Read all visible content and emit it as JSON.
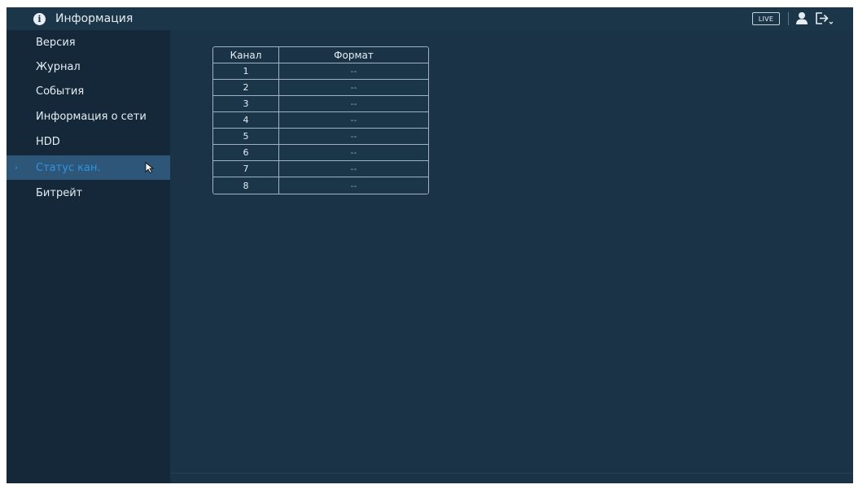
{
  "header": {
    "title": "Информация",
    "live_label": "LIVE"
  },
  "sidebar": {
    "items": [
      {
        "label": "Версия"
      },
      {
        "label": "Журнал"
      },
      {
        "label": "События"
      },
      {
        "label": "Информация о сети"
      },
      {
        "label": "HDD"
      },
      {
        "label": "Статус кан.",
        "active": true
      },
      {
        "label": "Битрейт"
      }
    ]
  },
  "table": {
    "columns": [
      "Канал",
      "Формат"
    ],
    "rows": [
      {
        "channel": "1",
        "format": "--"
      },
      {
        "channel": "2",
        "format": "--"
      },
      {
        "channel": "3",
        "format": "--"
      },
      {
        "channel": "4",
        "format": "--"
      },
      {
        "channel": "5",
        "format": "--"
      },
      {
        "channel": "6",
        "format": "--"
      },
      {
        "channel": "7",
        "format": "--"
      },
      {
        "channel": "8",
        "format": "--"
      }
    ]
  },
  "icons": {
    "header": "info-icon",
    "user": "user-icon",
    "logout": "logout-icon",
    "pointer": "mouse-cursor-icon",
    "active_marker": "chevron-right-icon"
  },
  "colors": {
    "background": "#1a3347",
    "sidebar": "#14283a",
    "active_item_bg": "#2e5678",
    "active_item_text": "#2e95e0"
  }
}
